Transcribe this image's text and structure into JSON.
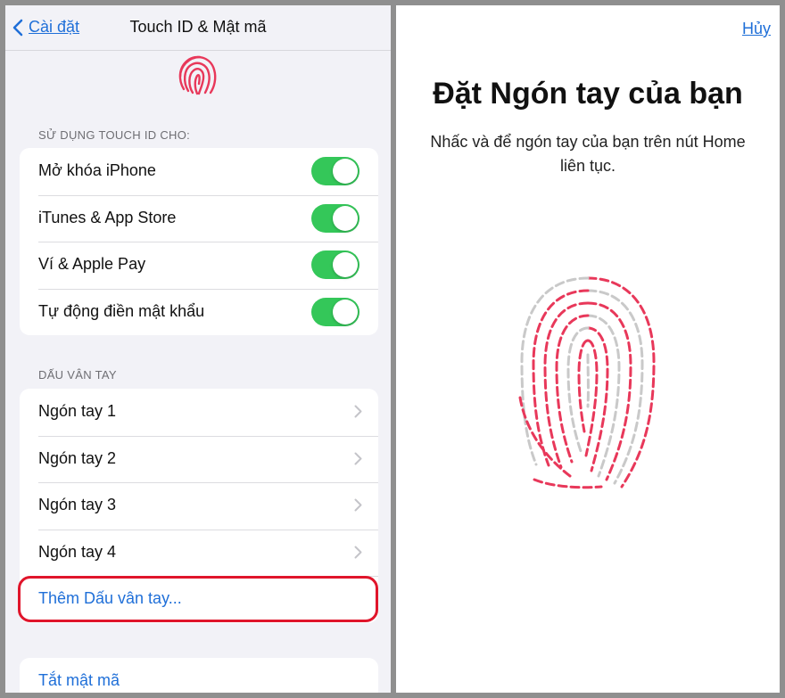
{
  "left_screen": {
    "nav": {
      "back_label": "Cài đặt",
      "title": "Touch ID & Mật mã"
    },
    "usage_section": {
      "header": "SỬ DỤNG TOUCH ID CHO:",
      "items": [
        {
          "label": "Mở khóa iPhone",
          "enabled": true
        },
        {
          "label": "iTunes & App Store",
          "enabled": true
        },
        {
          "label": "Ví & Apple Pay",
          "enabled": true
        },
        {
          "label": "Tự động điền mật khẩu",
          "enabled": true
        }
      ]
    },
    "fingerprint_section": {
      "header": "DẤU VÂN TAY",
      "items": [
        {
          "label": "Ngón tay 1"
        },
        {
          "label": "Ngón tay 2"
        },
        {
          "label": "Ngón tay 3"
        },
        {
          "label": "Ngón tay 4"
        }
      ],
      "add_label": "Thêm Dấu vân tay..."
    },
    "passcode": {
      "off_label": "Tắt mật mã"
    }
  },
  "right_screen": {
    "cancel_label": "Hủy",
    "title": "Đặt Ngón tay của bạn",
    "description": "Nhấc và để ngón tay của bạn trên nút Home liên tục."
  },
  "colors": {
    "accent": "#1f6fd8",
    "toggle_on": "#34c759",
    "fingerprint": "#e8385a",
    "highlight": "#e0152b"
  }
}
